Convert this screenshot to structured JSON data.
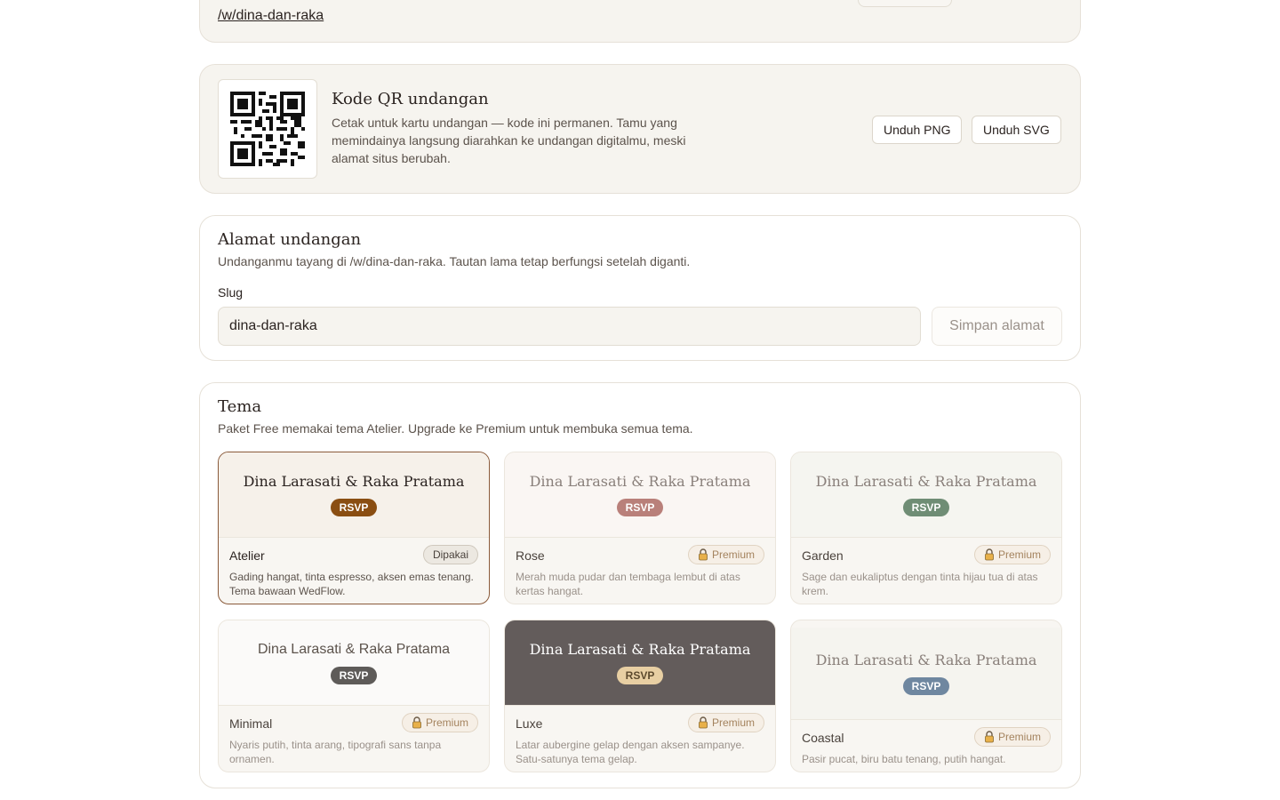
{
  "top_section": {
    "link": "/w/dina-dan-raka"
  },
  "qr_section": {
    "title": "Kode QR undangan",
    "description": "Cetak untuk kartu undangan — kode ini permanen. Tamu yang memindainya langsung diarahkan ke undangan digitalmu, meski alamat situs berubah.",
    "download_png": "Unduh PNG",
    "download_svg": "Unduh SVG"
  },
  "address_section": {
    "title": "Alamat undangan",
    "description": "Undanganmu tayang di /w/dina-dan-raka. Tautan lama tetap berfungsi setelah diganti.",
    "slug_label": "Slug",
    "slug_value": "dina-dan-raka",
    "save_label": "Simpan alamat"
  },
  "theme_section": {
    "title": "Tema",
    "description": "Paket Free memakai tema Atelier. Upgrade ke Premium untuk membuka semua tema.",
    "preview_names": "Dina Larasati & Raka Pratama",
    "rsvp_label": "RSVP",
    "themes": [
      {
        "name": "Atelier",
        "badge": "Dipakai",
        "description": "Gading hangat, tinta espresso, aksen emas tenang. Tema bawaan WedFlow.",
        "bg": "#f6f1ea",
        "text_color": "#2b2320",
        "rsvp_color": "#8a4e12"
      },
      {
        "name": "Rose",
        "badge": "Premium",
        "description": "Merah muda pudar dan tembaga lembut di atas kertas hangat.",
        "bg": "#faf6f3",
        "text_color": "#8a807b",
        "rsvp_color": "#b9807a"
      },
      {
        "name": "Garden",
        "badge": "Premium",
        "description": "Sage dan eukaliptus dengan tinta hijau tua di atas krem.",
        "bg": "#f5f5f0",
        "text_color": "#8a807b",
        "rsvp_color": "#6f8d75"
      },
      {
        "name": "Minimal",
        "badge": "Premium",
        "description": "Nyaris putih, tinta arang, tipografi sans tanpa ornamen.",
        "bg": "#fbfaf9",
        "text_color": "#5c534c",
        "rsvp_color": "#5e5b59"
      },
      {
        "name": "Luxe",
        "badge": "Premium",
        "description": "Latar aubergine gelap dengan aksen sampanye. Satu-satunya tema gelap.",
        "bg": "#635c5b",
        "text_color": "#ffffff",
        "rsvp_color": "#e8cfa3"
      },
      {
        "name": "Coastal",
        "badge": "Premium",
        "description": "Pasir pucat, biru batu tenang, putih hangat.",
        "bg": "#f5f4ef",
        "text_color": "#8a807b",
        "rsvp_color": "#6f87a0"
      }
    ]
  }
}
